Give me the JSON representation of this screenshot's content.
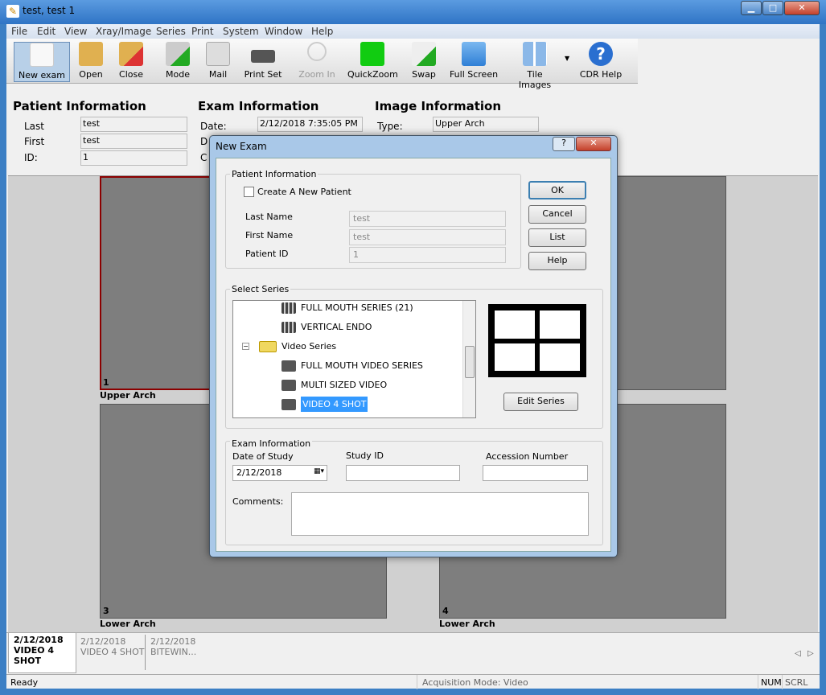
{
  "window": {
    "title": "test, test 1",
    "minimize": "▁",
    "maximize": "□",
    "close": "✕"
  },
  "menu": [
    "File",
    "Edit",
    "View",
    "Xray/Image",
    "Series",
    "Print",
    "System",
    "Window",
    "Help"
  ],
  "toolbar": [
    {
      "label": "New exam",
      "icon": "new-exam-icon",
      "active": true
    },
    {
      "label": "Open",
      "icon": "open-folder-icon"
    },
    {
      "label": "Close",
      "icon": "close-folder-icon"
    },
    {
      "label": "Mode",
      "icon": "camera-mode-icon"
    },
    {
      "label": "Mail",
      "icon": "mail-icon"
    },
    {
      "label": "Print Set",
      "icon": "printer-icon"
    },
    {
      "label": "Zoom In",
      "icon": "zoom-in-icon",
      "disabled": true
    },
    {
      "label": "QuickZoom",
      "icon": "quickzoom-icon"
    },
    {
      "label": "Swap",
      "icon": "swap-icon"
    },
    {
      "label": "Full Screen",
      "icon": "full-screen-icon"
    },
    {
      "label": "Tile Images",
      "icon": "tile-images-icon"
    },
    {
      "label": "CDR Help",
      "icon": "help-icon"
    }
  ],
  "patient_info": {
    "heading": "Patient Information",
    "last_label": "Last",
    "last": "test",
    "first_label": "First",
    "first": "test",
    "id_label": "ID:",
    "id": "1"
  },
  "exam_info": {
    "heading": "Exam Information",
    "date_label": "Date:",
    "date": "2/12/2018 7:35:05 PM",
    "d_label": "D",
    "c_label": "C"
  },
  "image_info": {
    "heading": "Image Information",
    "type_label": "Type:",
    "type": "Upper Arch"
  },
  "panels": [
    {
      "num": "1",
      "label": "Upper Arch"
    },
    {
      "num": "3",
      "label": "Lower Arch"
    },
    {
      "num": "4",
      "label": "Lower Arch"
    }
  ],
  "tabs": [
    {
      "date": "2/12/2018",
      "name": "VIDEO 4 SHOT",
      "active": true
    },
    {
      "date": "2/12/2018",
      "name": "VIDEO 4 SHOT"
    },
    {
      "date": "2/12/2018",
      "name": "BITEWIN..."
    }
  ],
  "status": {
    "left": "Ready",
    "mode": "Acquisition Mode: Video",
    "num": "NUM",
    "scrl": "SCRL"
  },
  "dialog": {
    "title": "New Exam",
    "help": "?",
    "close": "✕",
    "patient_group": "Patient Information",
    "create_new": "Create A New Patient",
    "create_checked": false,
    "last_name_label": "Last Name",
    "last_name": "test",
    "first_name_label": "First Name",
    "first_name": "test",
    "patient_id_label": "Patient ID",
    "patient_id": "1",
    "ok": "OK",
    "cancel": "Cancel",
    "list": "List",
    "help_btn": "Help",
    "series_group": "Select Series",
    "tree": [
      {
        "label": "FULL MOUTH SERIES (21)",
        "icon": "xray-series-icon",
        "level": 2
      },
      {
        "label": "VERTICAL ENDO",
        "icon": "xray-series-icon",
        "level": 2
      },
      {
        "label": "Video Series",
        "icon": "folder-icon",
        "level": 1,
        "expanded": true
      },
      {
        "label": "FULL MOUTH VIDEO SERIES",
        "icon": "camera-icon",
        "level": 2
      },
      {
        "label": "MULTI SIZED VIDEO",
        "icon": "camera-icon",
        "level": 2
      },
      {
        "label": "VIDEO 4 SHOT",
        "icon": "camera-icon",
        "level": 2,
        "selected": true
      }
    ],
    "edit_series": "Edit Series",
    "exam_group": "Exam Information",
    "date_of_study_label": "Date of Study",
    "date_of_study": "2/12/2018",
    "study_id_label": "Study ID",
    "study_id": "",
    "accession_label": "Accession Number",
    "accession": "",
    "comments_label": "Comments:",
    "comments": ""
  },
  "colors": {
    "selection": "#3399ff",
    "selected_panel_border": "#8b0000",
    "title_bar": "#3a7fcf"
  }
}
